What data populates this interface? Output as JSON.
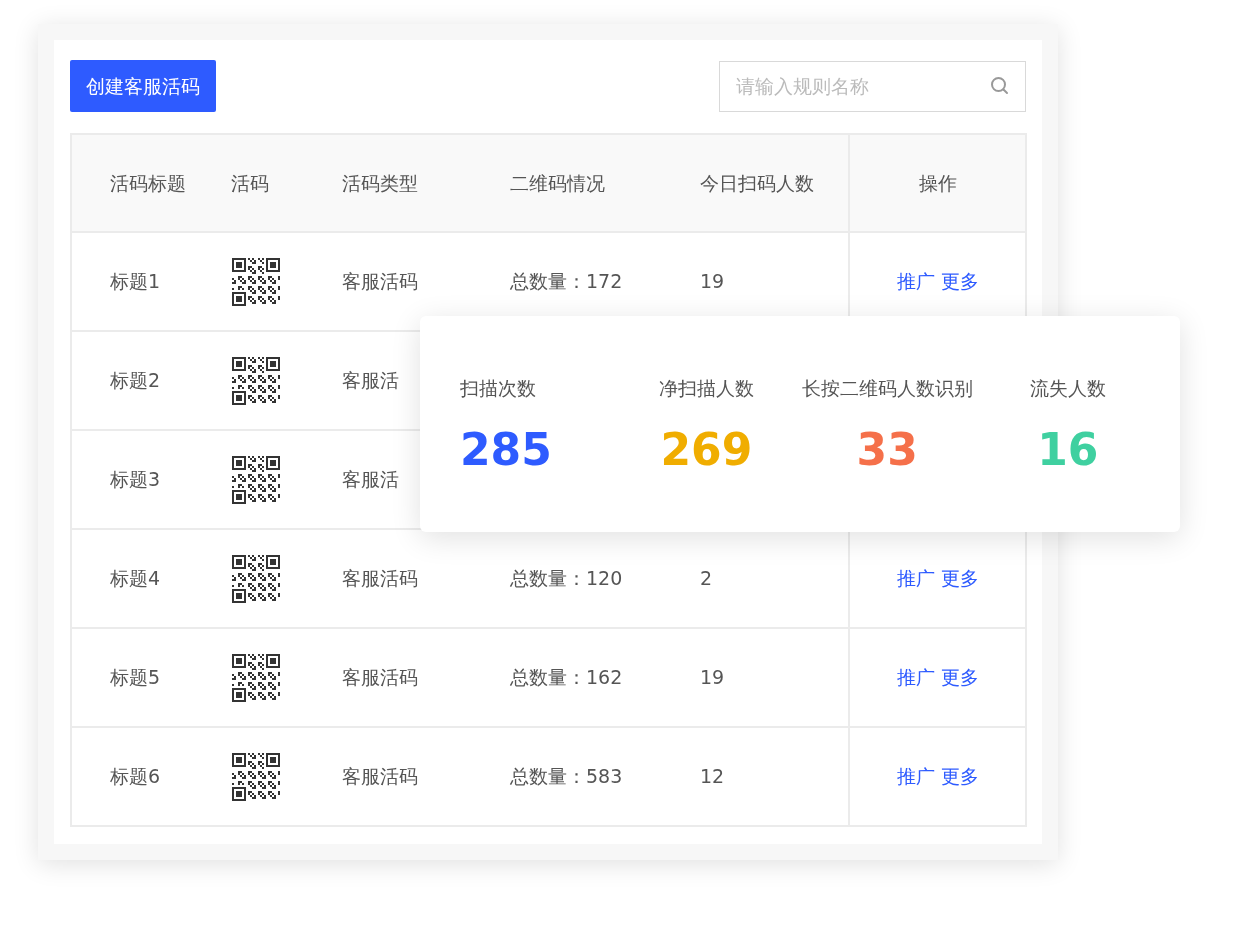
{
  "create_button": "创建客服活码",
  "search": {
    "placeholder": "请输入规则名称"
  },
  "table": {
    "columns": [
      "活码标题",
      "活码",
      "活码类型",
      "二维码情况",
      "今日扫码人数",
      "操作"
    ],
    "rows": [
      {
        "title": "标题1",
        "type": "客服活码",
        "total": "总数量：172",
        "today": "19",
        "actions": [
          "推广",
          "更多"
        ]
      },
      {
        "title": "标题2",
        "type": "客服活"
      },
      {
        "title": "标题3",
        "type": "客服活"
      },
      {
        "title": "标题4",
        "type": "客服活码",
        "total": "总数量：120",
        "today": "2",
        "actions": [
          "推广",
          "更多"
        ]
      },
      {
        "title": "标题5",
        "type": "客服活码",
        "total": "总数量：162",
        "today": "19",
        "actions": [
          "推广",
          "更多"
        ]
      },
      {
        "title": "标题6",
        "type": "客服活码",
        "total": "总数量：583",
        "today": "12",
        "actions": [
          "推广",
          "更多"
        ]
      }
    ]
  },
  "stats_popup": {
    "stats": [
      {
        "label": "扫描次数",
        "value": "285",
        "color": "#2e5bff"
      },
      {
        "label": "净扫描人数",
        "value": "269",
        "color": "#f0ad00"
      },
      {
        "label": "长按二维码人数识别",
        "value": "33",
        "color": "#f5704a"
      },
      {
        "label": "流失人数",
        "value": "16",
        "color": "#3fd0a0"
      }
    ]
  }
}
